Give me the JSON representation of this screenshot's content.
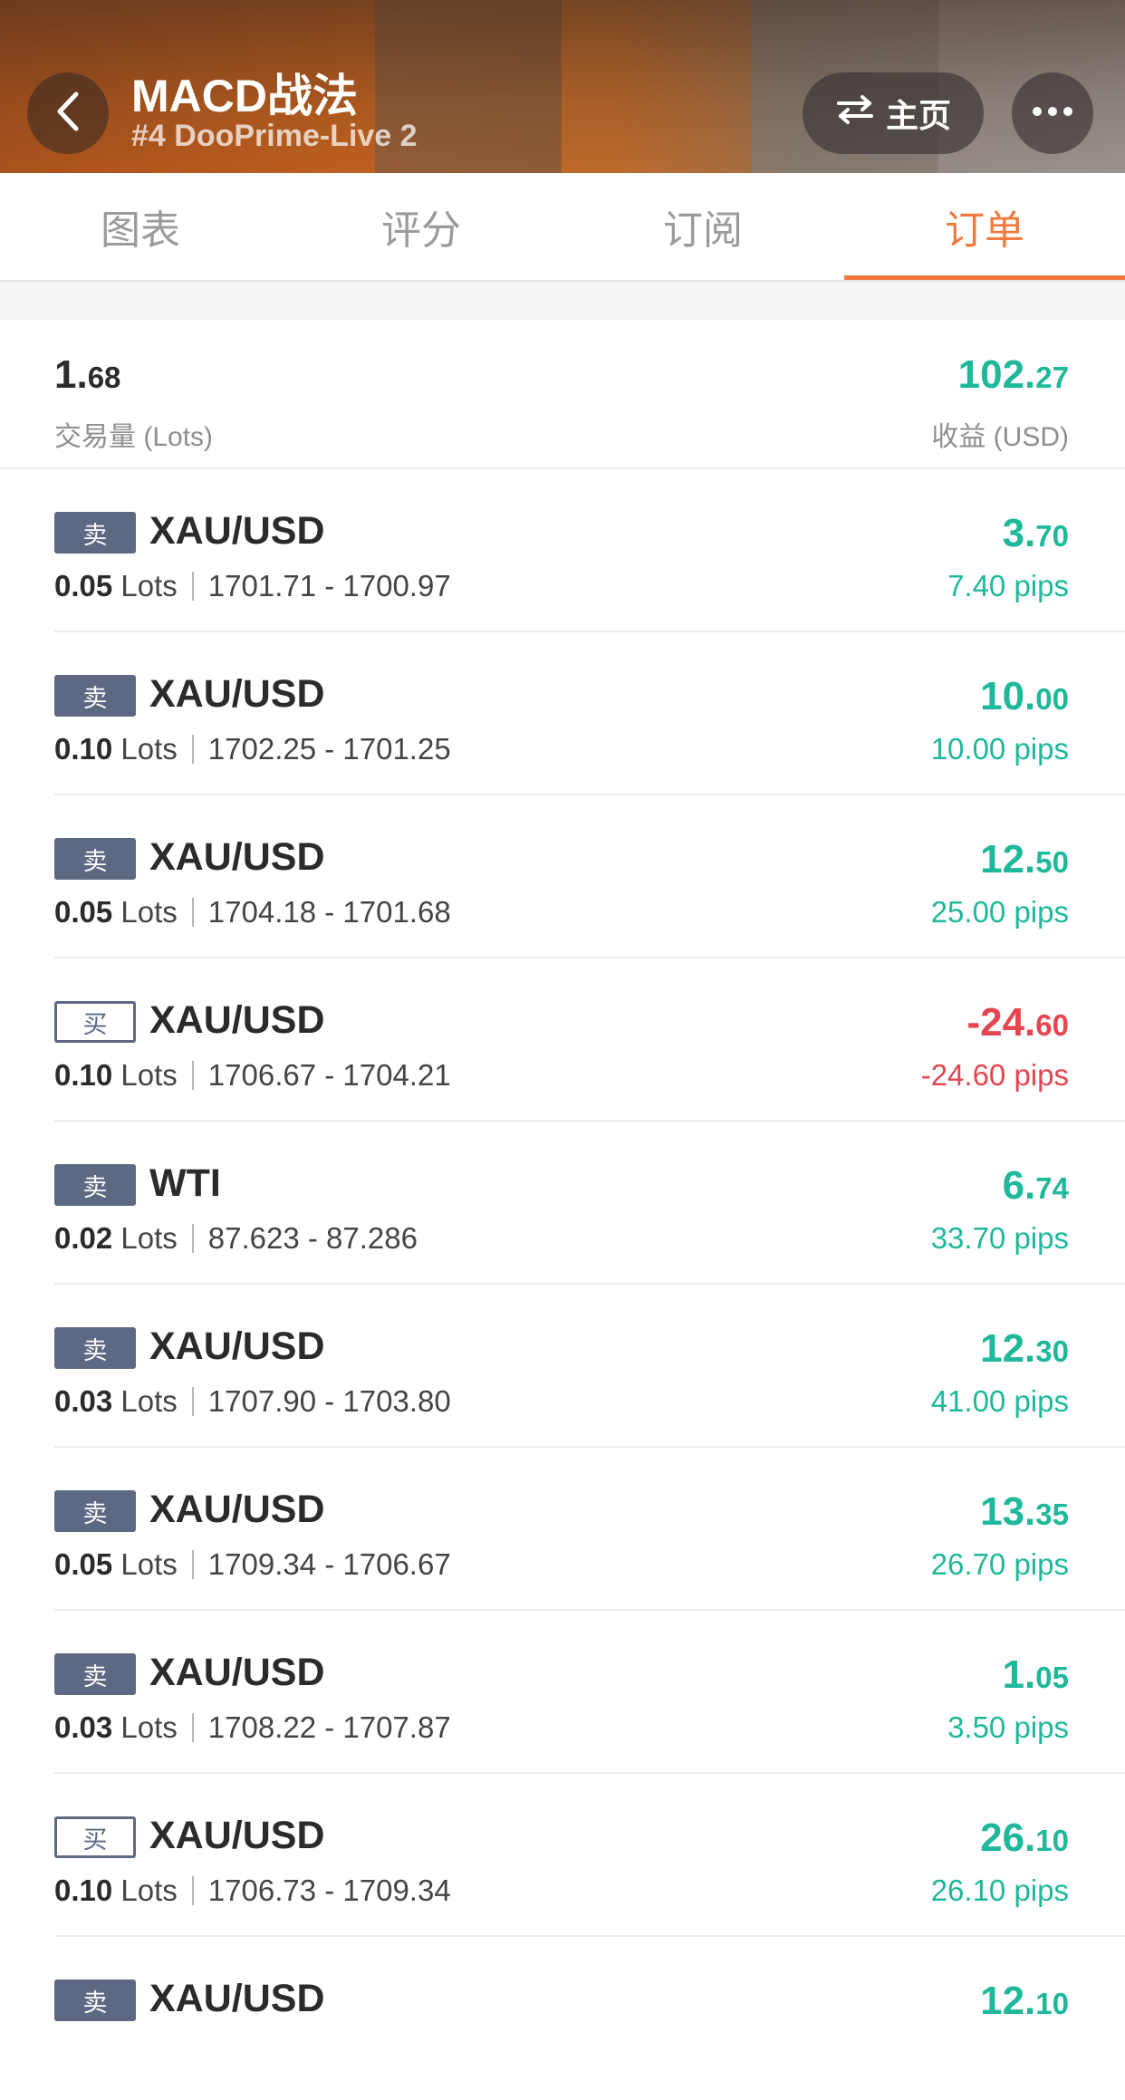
{
  "header": {
    "title": "MACD战法",
    "subtitle": "#4 DooPrime-Live 2",
    "home_label": "主页",
    "icons": {
      "back": "chevron-left-icon",
      "swap": "swap-arrows-icon",
      "more": "more-dots-icon"
    }
  },
  "tabs": [
    {
      "label": "图表",
      "active": false
    },
    {
      "label": "评分",
      "active": false
    },
    {
      "label": "订阅",
      "active": false
    },
    {
      "label": "订单",
      "active": true
    }
  ],
  "summary": {
    "volume_int": "1.",
    "volume_dec": "68",
    "volume_label": "交易量 (Lots)",
    "profit_int": "102.",
    "profit_dec": "27",
    "profit_label": "收益 (USD)"
  },
  "lots_unit": "Lots",
  "orders": [
    {
      "side": "卖",
      "type": "sell",
      "symbol": "XAU/USD",
      "lots": "0.05",
      "prices": "1701.71 - 1700.97",
      "profit_int": "3.",
      "profit_dec": "70",
      "pips": "7.40 pips",
      "positive": true
    },
    {
      "side": "卖",
      "type": "sell",
      "symbol": "XAU/USD",
      "lots": "0.10",
      "prices": "1702.25 - 1701.25",
      "profit_int": "10.",
      "profit_dec": "00",
      "pips": "10.00 pips",
      "positive": true
    },
    {
      "side": "卖",
      "type": "sell",
      "symbol": "XAU/USD",
      "lots": "0.05",
      "prices": "1704.18 - 1701.68",
      "profit_int": "12.",
      "profit_dec": "50",
      "pips": "25.00 pips",
      "positive": true
    },
    {
      "side": "买",
      "type": "buy",
      "symbol": "XAU/USD",
      "lots": "0.10",
      "prices": "1706.67 - 1704.21",
      "profit_int": "-24.",
      "profit_dec": "60",
      "pips": "-24.60 pips",
      "positive": false
    },
    {
      "side": "卖",
      "type": "sell",
      "symbol": "WTI",
      "lots": "0.02",
      "prices": "87.623 - 87.286",
      "profit_int": "6.",
      "profit_dec": "74",
      "pips": "33.70 pips",
      "positive": true
    },
    {
      "side": "卖",
      "type": "sell",
      "symbol": "XAU/USD",
      "lots": "0.03",
      "prices": "1707.90 - 1703.80",
      "profit_int": "12.",
      "profit_dec": "30",
      "pips": "41.00 pips",
      "positive": true
    },
    {
      "side": "卖",
      "type": "sell",
      "symbol": "XAU/USD",
      "lots": "0.05",
      "prices": "1709.34 - 1706.67",
      "profit_int": "13.",
      "profit_dec": "35",
      "pips": "26.70 pips",
      "positive": true
    },
    {
      "side": "卖",
      "type": "sell",
      "symbol": "XAU/USD",
      "lots": "0.03",
      "prices": "1708.22 - 1707.87",
      "profit_int": "1.",
      "profit_dec": "05",
      "pips": "3.50 pips",
      "positive": true
    },
    {
      "side": "买",
      "type": "buy",
      "symbol": "XAU/USD",
      "lots": "0.10",
      "prices": "1706.73 - 1709.34",
      "profit_int": "26.",
      "profit_dec": "10",
      "pips": "26.10 pips",
      "positive": true
    },
    {
      "side": "卖",
      "type": "sell",
      "symbol": "XAU/USD",
      "lots": "",
      "prices": "",
      "profit_int": "12.",
      "profit_dec": "10",
      "pips": "",
      "positive": true
    }
  ],
  "colors": {
    "accent": "#f07a3e",
    "positive": "#1fb89a",
    "negative": "#e5454f",
    "sell_badge": "#5d6882"
  }
}
